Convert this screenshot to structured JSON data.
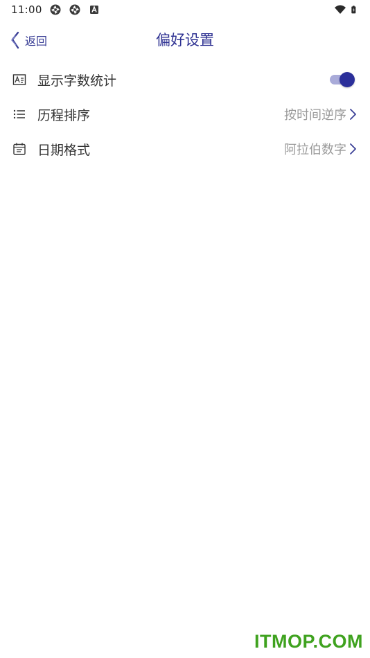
{
  "status_bar": {
    "time": "11:00",
    "left_icons": [
      "aperture-icon",
      "aperture-icon",
      "font-a-icon"
    ],
    "right_icons": [
      "wifi-icon",
      "battery-charging-icon"
    ]
  },
  "header": {
    "back_label": "返回",
    "title": "偏好设置"
  },
  "settings": {
    "word_count": {
      "icon": "text-box-icon",
      "label": "显示字数统计",
      "enabled": true
    },
    "history_order": {
      "icon": "list-icon",
      "label": "历程排序",
      "value": "按时间逆序"
    },
    "date_format": {
      "icon": "calendar-icon",
      "label": "日期格式",
      "value": "阿拉伯数字"
    }
  },
  "watermark": "ITMOP.COM",
  "colors": {
    "accent": "#2e3192",
    "toggle_track": "#a9abd9",
    "secondary_text": "#9a9a9a",
    "watermark": "#3fa21f"
  }
}
